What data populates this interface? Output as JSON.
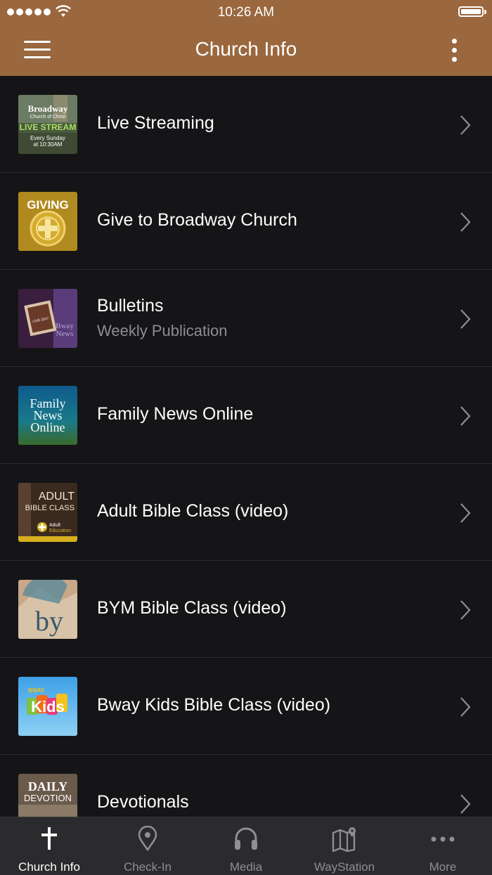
{
  "status_bar": {
    "time": "10:26 AM"
  },
  "header": {
    "title": "Church Info"
  },
  "items": [
    {
      "title": "Live Streaming",
      "subtitle": "",
      "thumb": {
        "line1": "Broadway",
        "line2": "Church of Christ",
        "line3": "LIVE STREAM",
        "line4": "Every Sunday",
        "line5": "at 10:30AM"
      }
    },
    {
      "title": "Give to Broadway Church",
      "subtitle": "",
      "thumb": {
        "line1": "GIVING"
      }
    },
    {
      "title": "Bulletins",
      "subtitle": "Weekly Publication",
      "thumb": {
        "line1": "LIVE 2017",
        "line2": "Bway",
        "line3": "News"
      }
    },
    {
      "title": "Family News Online",
      "subtitle": "",
      "thumb": {
        "line1": "Family",
        "line2": "News",
        "line3": "Online"
      }
    },
    {
      "title": "Adult Bible Class (video)",
      "subtitle": "",
      "thumb": {
        "line1": "ADULT",
        "line2": "BIBLE CLASS",
        "line3": "Adult",
        "line4": "Education"
      }
    },
    {
      "title": "BYM Bible Class (video)",
      "subtitle": "",
      "thumb": {
        "line1": "by"
      }
    },
    {
      "title": "Bway Kids Bible Class (video)",
      "subtitle": "",
      "thumb": {
        "line1": "BWAY",
        "line2": "Kids"
      }
    },
    {
      "title": "Devotionals",
      "subtitle": "",
      "thumb": {
        "line1": "DAILY",
        "line2": "DEVOTION"
      }
    }
  ],
  "tabbar": {
    "tabs": [
      {
        "label": "Church Info",
        "icon": "cross-icon",
        "active": true
      },
      {
        "label": "Check-In",
        "icon": "location-pin-icon",
        "active": false
      },
      {
        "label": "Media",
        "icon": "headphones-icon",
        "active": false
      },
      {
        "label": "WayStation",
        "icon": "map-icon",
        "active": false
      },
      {
        "label": "More",
        "icon": "more-dots-icon",
        "active": false
      }
    ]
  },
  "colors": {
    "header_bg": "#9a673e",
    "list_bg": "#151517",
    "tabbar_bg": "#2b2b2d",
    "inactive_tab": "#8e8e93"
  }
}
